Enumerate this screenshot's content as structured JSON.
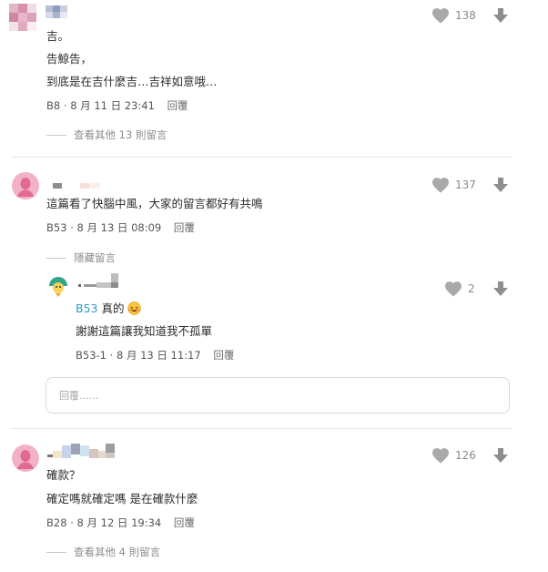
{
  "comments": [
    {
      "like_count": "138",
      "lines": [
        "吉。",
        "告鯨告，",
        "到底是在吉什麼吉…吉祥如意哦…"
      ],
      "floor": "B8",
      "date": "8 月 11 日 23:41",
      "reply_label": "回覆",
      "more_label": "查看其他 13 則留言"
    },
    {
      "like_count": "137",
      "lines": [
        "這篇看了快腦中風，大家的留言都好有共鳴"
      ],
      "floor": "B53",
      "date": "8 月 13 日 08:09",
      "reply_label": "回覆",
      "hide_label": "隱藏留言",
      "reply": {
        "like_count": "2",
        "mention": "B53",
        "mention_text": "真的",
        "text": "謝謝這篇讓我知道我不孤單",
        "floor": "B53-1",
        "date": "8 月 13 日 11:17",
        "reply_label": "回覆"
      },
      "reply_box": {
        "placeholder": "回覆......"
      }
    },
    {
      "like_count": "126",
      "lines": [
        "確款？",
        "確定嗎就確定嗎 是在確款什麼"
      ],
      "floor": "B28",
      "date": "8 月 12 日 19:34",
      "reply_label": "回覆",
      "more_label": "查看其他 4 則留言"
    }
  ],
  "colors": {
    "avatar_pink": "#e8a0b4",
    "heart": "#a9a9a9",
    "mention": "#3397cf"
  },
  "icons": {
    "like": "heart-icon",
    "dislike": "arrow-down-icon",
    "reaction": "laughing-emoji-icon"
  }
}
